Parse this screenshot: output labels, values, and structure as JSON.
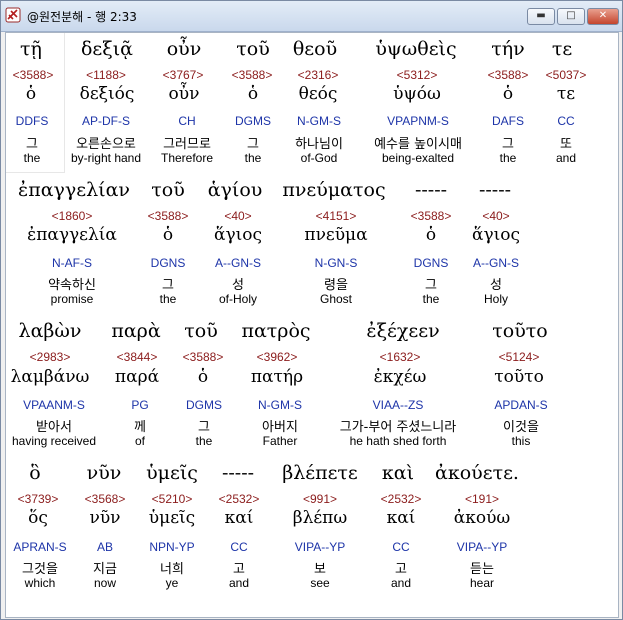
{
  "window": {
    "title": "@원전분해 - 행 2:33",
    "controls": {
      "minimize": "▬",
      "maximize": "□",
      "close": "✕"
    }
  },
  "rows": [
    {
      "greek": [
        "τῇ",
        "δεξιᾷ",
        "οὖν",
        "τοῦ",
        "θεοῦ",
        "ὑψωθεὶς",
        "τήν",
        "τε"
      ],
      "strong": [
        "<3588>",
        "<1188>",
        "<3767>",
        "<3588>",
        "<2316>",
        "<5312>",
        "<3588>",
        "<5037>"
      ],
      "lemma": [
        "ὁ",
        "δεξιός",
        "οὖν",
        "ὁ",
        "θεός",
        "ὑψόω",
        "ὁ",
        "τε"
      ],
      "parse": [
        "DDFS",
        "AP-DF-S",
        "CH",
        "DGMS",
        "N-GM-S",
        "VPAPNM-S",
        "DAFS",
        "CC"
      ],
      "korean": [
        "그",
        "오른손으로",
        "그러므로",
        "그",
        "하나님이",
        "예수를 높이시매",
        "그",
        "또"
      ],
      "english": [
        "the",
        "by-right hand",
        "Therefore",
        "the",
        "of-God",
        "being-exalted",
        "the",
        "and"
      ]
    },
    {
      "greek": [
        "ἐπαγγελίαν",
        "τοῦ",
        "ἁγίου",
        "πνεύματος",
        "-----",
        "-----"
      ],
      "strong": [
        "<1860>",
        "<3588>",
        "<40>",
        "<4151>",
        "<3588>",
        "<40>"
      ],
      "lemma": [
        "ἐπαγγελία",
        "ὁ",
        "ἅγιος",
        "πνεῦμα",
        "ὁ",
        "ἅγιος"
      ],
      "parse": [
        "N-AF-S",
        "DGNS",
        "A--GN-S",
        "N-GN-S",
        "DGNS",
        "A--GN-S"
      ],
      "korean": [
        "약속하신",
        "그",
        "성",
        "령을",
        "그",
        "성"
      ],
      "english": [
        "promise",
        "the",
        "of-Holy",
        "Ghost",
        "the",
        "Holy"
      ]
    },
    {
      "greek": [
        "λαβὼν",
        "παρὰ",
        "τοῦ",
        "πατρὸς",
        "ἐξέχεεν",
        "τοῦτο"
      ],
      "strong": [
        "<2983>",
        "<3844>",
        "<3588>",
        "<3962>",
        "<1632>",
        "<5124>"
      ],
      "lemma": [
        "λαμβάνω",
        "παρά",
        "ὁ",
        "πατήρ",
        "ἐκχέω",
        "τοῦτο"
      ],
      "parse": [
        "VPAANM-S",
        "PG",
        "DGMS",
        "N-GM-S",
        "VIAA--ZS",
        "APDAN-S"
      ],
      "korean": [
        "받아서",
        "께",
        "그",
        "아버지",
        "그가-부어 주셨느니라",
        "이것을"
      ],
      "english": [
        "having received",
        "of",
        "the",
        "Father",
        "he hath shed forth",
        "this"
      ]
    },
    {
      "greek": [
        "ὃ",
        "νῦν",
        "ὑμεῖς",
        "-----",
        "βλέπετε",
        "καὶ",
        "ἀκούετε."
      ],
      "strong": [
        "<3739>",
        "<3568>",
        "<5210>",
        "<2532>",
        "<991>",
        "<2532>",
        "<191>"
      ],
      "lemma": [
        "ὅς",
        "νῦν",
        "ὑμεῖς",
        "καί",
        "βλέπω",
        "καί",
        "ἀκούω"
      ],
      "parse": [
        "APRAN-S",
        "AB",
        "NPN-YP",
        "CC",
        "VIPA--YP",
        "CC",
        "VIPA--YP"
      ],
      "korean": [
        "그것을",
        "지금",
        "너희",
        "고",
        "보",
        "고",
        "듣는"
      ],
      "english": [
        "which",
        "now",
        "ye",
        "and",
        "see",
        "and",
        "hear"
      ]
    }
  ]
}
